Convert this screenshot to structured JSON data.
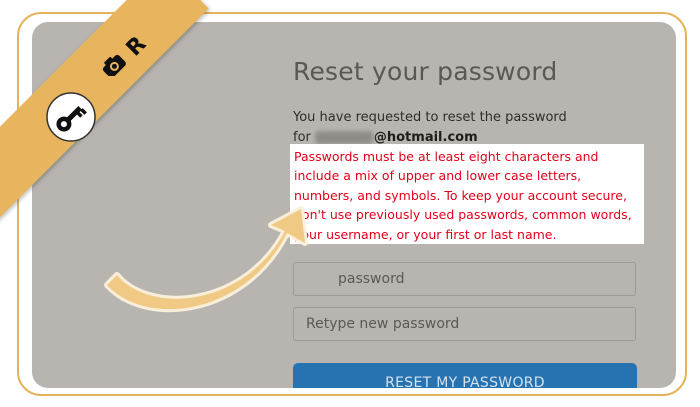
{
  "badge": {
    "letter": "R"
  },
  "page": {
    "title": "Reset your password",
    "requested_text": "You have requested to reset the password",
    "for_label": "for",
    "email_domain": "@hotmail.com",
    "rules_text": "Passwords must be at least eight characters and include a mix of upper and lower case letters, numbers, and symbols. To keep your account secure, don't use previously used passwords, common words, your username, or your first or last name."
  },
  "form": {
    "new_password_placeholder": "password",
    "retype_placeholder": "Retype new password",
    "submit_label": "RESET MY PASSWORD"
  },
  "colors": {
    "accent_orange": "#e8b55e",
    "rules_red": "#e3001b",
    "button_blue": "#2773b2",
    "overlay_gray": "#b8b5b0"
  }
}
